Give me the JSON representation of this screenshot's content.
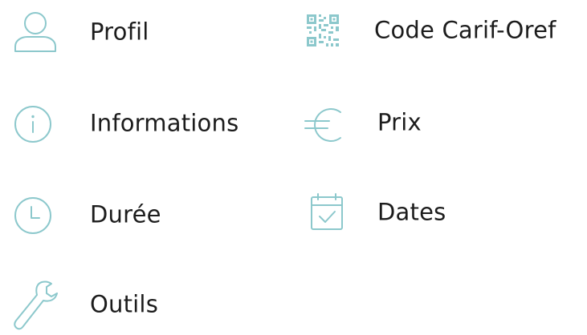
{
  "accent_color": "#8cc8cc",
  "items": [
    {
      "icon": "user-icon",
      "label": "Profil"
    },
    {
      "icon": "qr-code-icon",
      "label": "Code Carif-Oref"
    },
    {
      "icon": "info-icon",
      "label": "Informations"
    },
    {
      "icon": "euro-icon",
      "label": "Prix"
    },
    {
      "icon": "clock-icon",
      "label": "Durée"
    },
    {
      "icon": "calendar-check-icon",
      "label": "Dates"
    },
    {
      "icon": "wrench-icon",
      "label": "Outils"
    }
  ]
}
